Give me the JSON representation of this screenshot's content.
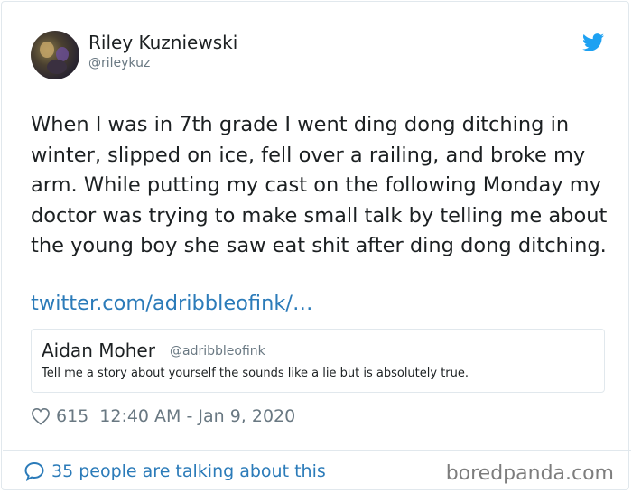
{
  "author": {
    "name": "Riley Kuzniewski",
    "handle": "@rileykuz"
  },
  "tweet": {
    "text": "When I was in 7th grade I went ding dong ditching in winter, slipped on ice, fell over a railing, and broke my arm. While putting my cast on the following Monday my doctor was trying to make small talk by telling me about the young boy she saw eat shit after ding dong ditching.",
    "link": "twitter.com/adribbleofink/…"
  },
  "quoted_tweet": {
    "name": "Aidan Moher",
    "handle": "@adribbleofink",
    "text": "Tell me a story about yourself the sounds like a lie but is absolutely true."
  },
  "meta": {
    "likes": "615",
    "timestamp": "12:40 AM - Jan 9, 2020"
  },
  "footer": {
    "talking": "35 people are talking about this",
    "watermark": "boredpanda.com"
  },
  "icons": {
    "brand": "twitter-bird-icon",
    "like": "heart-icon",
    "reply": "speech-bubble-icon"
  },
  "colors": {
    "link": "#2b7bb9",
    "twitter_blue": "#1da1f2",
    "muted": "#697882",
    "text": "#1c2022",
    "border": "#e1e8ed"
  }
}
